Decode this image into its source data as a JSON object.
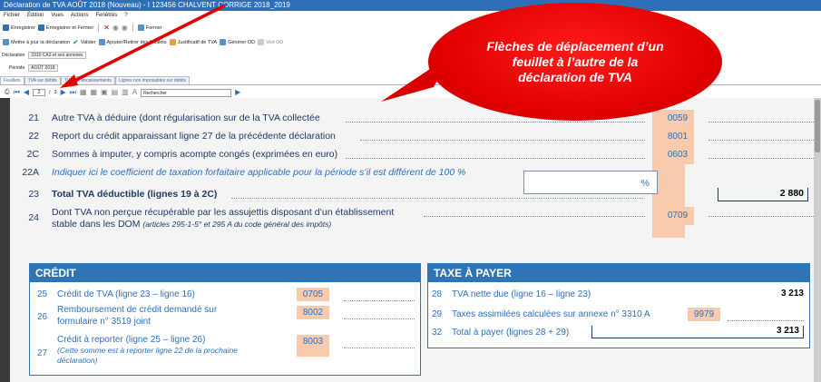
{
  "window": {
    "title": "Déclaration de TVA AOÛT 2018 (Nouveau) - I 123456 CHALVENT CORRIGE 2018_2019"
  },
  "menu": [
    "Fichier",
    "Édition",
    "Vues",
    "Actions",
    "Fenêtres",
    "?"
  ],
  "toolbar1": {
    "save": "Enregistrer",
    "save_close": "Enregistrer et Fermer",
    "close": "Fermer"
  },
  "toolbar2": {
    "update": "Mettre à jour la déclaration",
    "validate": "Valider",
    "add_remove": "Ajouter/Retirer des feuillets",
    "justif": "Justificatif de TVA",
    "generate": "Générer OD",
    "view": "Voir OD"
  },
  "declaration": {
    "label": "Déclaration",
    "value": "3310 CA3 et ses annexes"
  },
  "periode": {
    "label": "Période",
    "value": "AOÛT 2018"
  },
  "tabs": [
    "Feuillets",
    "TVA sur débits",
    "TVA sur encaissements",
    "Lignes non imposables sur débits"
  ],
  "nav": {
    "page": "2",
    "total": "3",
    "search_placeholder": "Rechercher"
  },
  "callout": {
    "text": "Flèches de déplacement d’un feuillet à l’autre de la déclaration de TVA"
  },
  "deductible": [
    {
      "num": "21",
      "label": "Autre TVA à déduire (dont régularisation sur de la TVA collectée",
      "code": "0059"
    },
    {
      "num": "22",
      "label": "Report du crédit apparaissant ligne 27 de la précédente déclaration",
      "code": "8001"
    },
    {
      "num": "2C",
      "label": "Sommes à imputer, y compris acompte congés (exprimées en euro)",
      "code": "0603"
    },
    {
      "num": "22A",
      "label": "Indiquer ici le coefficient de taxation forfaitaire applicable pour la période s’il est différent de 100 %",
      "unit": "%"
    },
    {
      "num": "23",
      "label": "Total TVA déductible (lignes 19 à 2C)",
      "amount": "2 880"
    },
    {
      "num": "24",
      "label1": "Dont TVA non perçue récupérable par les assujettis disposant d’un établissement",
      "label2": "stable dans les DOM",
      "label2note": "(articles 295-1-5° et 295 A du code général des impôts)",
      "code": "0709"
    }
  ],
  "credit": {
    "header": "CRÉDIT",
    "lines": [
      {
        "num": "25",
        "label": "Crédit de TVA (ligne 23 – ligne 16)",
        "code": "0705"
      },
      {
        "num": "26",
        "label1": "Remboursement de crédit demandé sur",
        "label2": "formulaire n° 3519 joint",
        "code": "8002"
      },
      {
        "num": "27",
        "label1": "Crédit à reporter (ligne 25 – ligne 26)",
        "note1": "(Cette somme est à reporter ligne 22 de la prochaine",
        "note2": "déclaration)",
        "code": "8003"
      }
    ]
  },
  "taxe": {
    "header": "TAXE À PAYER",
    "lines": [
      {
        "num": "28",
        "label": "TVA nette due (ligne 16 – ligne 23)",
        "amount": "3 213"
      },
      {
        "num": "29",
        "label": "Taxes assimilées calculées sur annexe n° 3310 A",
        "code": "9979"
      },
      {
        "num": "32",
        "label": "Total à payer (lignes 28 + 29)",
        "amount": "3 213"
      }
    ]
  }
}
